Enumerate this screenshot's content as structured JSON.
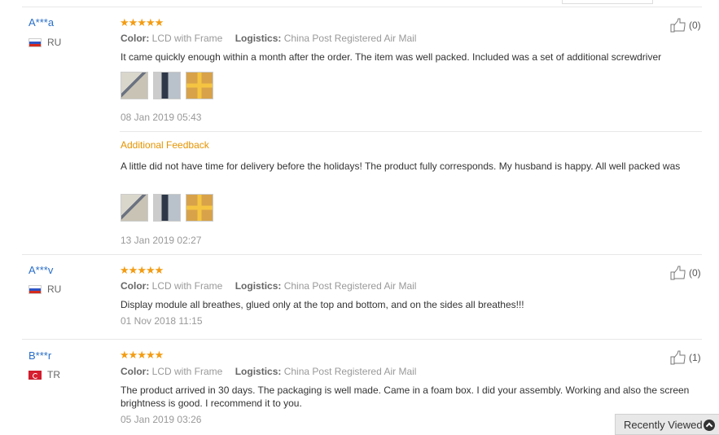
{
  "reviews": [
    {
      "user": "A***a",
      "country": "RU",
      "rating": 5,
      "color_label": "Color:",
      "color_value": "LCD with Frame",
      "logistics_label": "Logistics:",
      "logistics_value": "China Post Registered Air Mail",
      "text": "It came quickly enough within a month after the order. The item was well packed. Included was a set of additional screwdriver",
      "date": "08 Jan 2019 05:43",
      "likes": "(0)",
      "additional_label": "Additional Feedback",
      "additional_text": "A little did not have time for delivery before the holidays! The product fully corresponds. My husband is happy. All well packed was",
      "additional_date": "13 Jan 2019 02:27"
    },
    {
      "user": "A***v",
      "country": "RU",
      "rating": 5,
      "color_label": "Color:",
      "color_value": "LCD with Frame",
      "logistics_label": "Logistics:",
      "logistics_value": "China Post Registered Air Mail",
      "text": "Display module all breathes, glued only at the top and bottom, and on the sides all breathes!!!",
      "date": "01 Nov 2018 11:15",
      "likes": "(0)"
    },
    {
      "user": "B***r",
      "country": "TR",
      "rating": 5,
      "color_label": "Color:",
      "color_value": "LCD with Frame",
      "logistics_label": "Logistics:",
      "logistics_value": "China Post Registered Air Mail",
      "text": "The product arrived in 30 days. The packaging is well made. Came in a foam box. I did your assembly. Working and also the screen brightness is good. I recommend it to you.",
      "date": "05 Jan 2019 03:26",
      "likes": "(1)"
    }
  ],
  "recently_viewed": "Recently Viewed",
  "colors": {
    "user_link": "#2a6fc9",
    "star": "#f39c12",
    "additional": "#e59400"
  },
  "icons": {
    "like": "thumbs-up-icon",
    "flag_ru": "russia-flag-icon",
    "flag_tr": "turkey-flag-icon"
  }
}
